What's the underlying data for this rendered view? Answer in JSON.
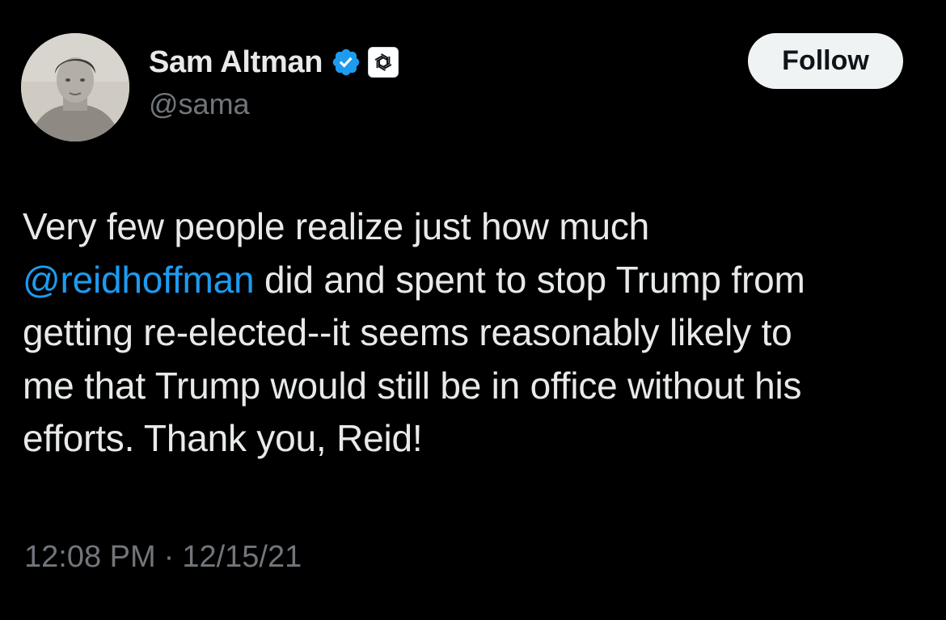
{
  "author": {
    "display_name": "Sam Altman",
    "handle": "@sama",
    "verified_badge_color": "#1d9bf0",
    "affiliate_icon": "openai-logo-icon"
  },
  "follow_button": {
    "label": "Follow"
  },
  "tweet": {
    "line1": "Very few people realize just how much",
    "mention": "@reidhoffman",
    "line2_rest": " did and spent to stop Trump from",
    "line3": "getting re-elected--it seems reasonably likely to",
    "line4": "me that Trump would still be in office without his",
    "line5": "efforts. Thank you, Reid!"
  },
  "meta": {
    "time": "12:08 PM",
    "separator": "·",
    "date": "12/15/21"
  },
  "colors": {
    "background": "#000000",
    "text": "#e7e9ea",
    "secondary": "#71767b",
    "link": "#1d9bf0",
    "follow_bg": "#eff3f4"
  }
}
